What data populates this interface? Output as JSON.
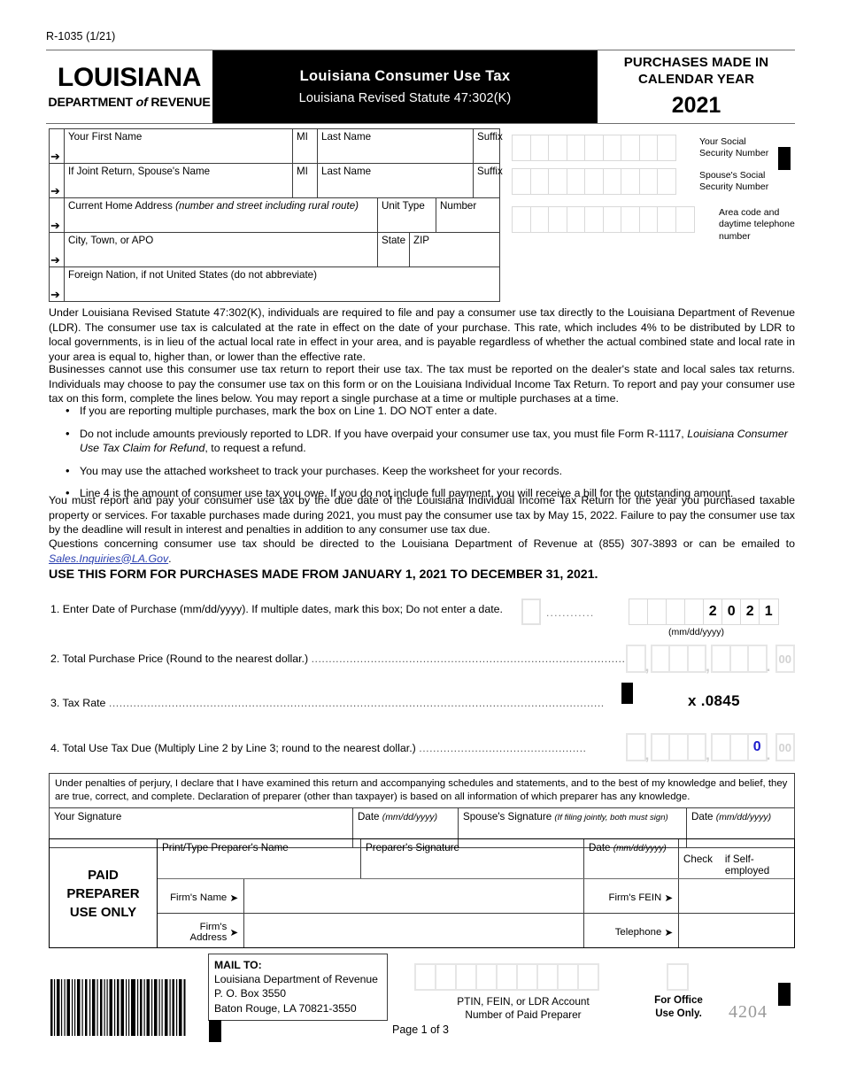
{
  "form": {
    "number": "R-1035 (1/21)",
    "logo_main": "LOUISIANA",
    "logo_sub_1": "DEPARTMENT",
    "logo_sub_of": "of",
    "logo_sub_2": "REVENUE",
    "title": "Louisiana Consumer Use Tax",
    "statute": "Louisiana Revised Statute 47:302(K)",
    "purchases_made_line1": "PURCHASES MADE IN",
    "purchases_made_line2": "CALENDAR YEAR",
    "year": "2021"
  },
  "name_block": {
    "your_first_name": "Your First Name",
    "mi": "MI",
    "last_name": "Last Name",
    "suffix": "Suffix",
    "spouse_name": "If Joint Return, Spouse's Name",
    "mi2": "MI",
    "last_name2": "Last Name",
    "suffix2": "Suffix",
    "address": "Current Home Address",
    "address_italic": "(number and street including rural route)",
    "unit_type": "Unit Type",
    "number": "Number",
    "city": "City, Town, or APO",
    "state": "State",
    "zip": "ZIP",
    "foreign_nation": "Foreign Nation, if not United States (do not abbreviate)"
  },
  "id_block": {
    "your_ssn_line1": "Your Social",
    "your_ssn_line2": "Security Number",
    "spouse_ssn_line1": "Spouse's Social",
    "spouse_ssn_line2": "Security Number",
    "phone_line1": "Area code and",
    "phone_line2": "daytime telephone",
    "phone_line3": "number",
    "ssn_cell_count": 9,
    "phone_cell_count": 10
  },
  "intro": {
    "p1": "Under Louisiana Revised Statute 47:302(K), individuals are required to file and pay a consumer use tax directly to the Louisiana Department of Revenue (LDR). The consumer use tax is calculated at the rate in effect on the date of your purchase. This rate, which includes 4% to be distributed by LDR to local governments, is in lieu of the actual local rate in effect in your area, and is payable regardless of whether the actual combined state and local rate in your area is equal to, higher than, or lower than the effective rate.",
    "p2": "Businesses cannot use this consumer use tax return to report their use tax. The tax must be reported on the dealer's state and local sales tax returns. Individuals may choose to pay the consumer use tax on this form or on the Louisiana Individual Income Tax Return. To report and pay your consumer use tax on this form, complete the lines below. You may report a single purchase at a time or multiple purchases at a time.",
    "bullet1": "If you are reporting multiple purchases, mark the box on Line 1. DO NOT enter a date.",
    "bullet2_a": "Do not include amounts previously reported to LDR. If you have overpaid your consumer use tax, you must file Form R-1117, ",
    "bullet2_i": "Louisiana Consumer Use Tax Claim for Refund",
    "bullet2_b": ", to request a refund.",
    "bullet3": "You may use the attached worksheet to track your purchases. Keep the worksheet for your records.",
    "bullet4": "Line 4 is the amount of consumer use tax you owe. If you do not include full payment, you will receive a bill for the outstanding amount.",
    "p3": "You must report and pay your consumer use tax by the due date of the Louisiana Individual Income Tax Return for the year you purchased taxable property or services. For taxable purchases made during 2021, you must pay the consumer use tax by May 15, 2022. Failure to pay the consumer use tax by the deadline will result in interest and penalties in addition to any consumer use tax due.",
    "p4_a": "Questions concerning consumer use tax should be directed to the Louisiana Department of Revenue at (855) 307-3893 or can be emailed to ",
    "p4_link": "Sales.Inquiries@LA.Gov",
    "p4_b": ".",
    "use_this_form": "USE THIS FORM FOR PURCHASES MADE FROM JANUARY 1, 2021 TO DECEMBER 31, 2021."
  },
  "lines": {
    "line1_label": "1. Enter Date of Purchase (mm/dd/yyyy). If multiple dates, mark this box; Do not enter a date.",
    "line1_dots": "............",
    "line1_date_cells": [
      "",
      "",
      "",
      "",
      "2",
      "0",
      "2",
      "1"
    ],
    "line1_format_hint": "(mm/dd/yyyy)",
    "line2_label": "2. Total Purchase Price (Round to the nearest dollar.)",
    "line2_dots": "..........................................................................................",
    "line2_cents": "00",
    "line3_label": "3. Tax Rate",
    "line3_dots": "..............................................................................................................................................",
    "line3_rate": "x .0845",
    "line4_label": "4. Total Use Tax Due (Multiply Line 2 by Line 3; round to the nearest dollar.)",
    "line4_dots": "................................................",
    "line4_value": "0",
    "line4_cents": "00"
  },
  "signature": {
    "perjury": "Under penalties of perjury, I declare that I have examined this return and accompanying schedules and statements, and to the best of my knowledge and belief, they are true, correct, and complete. Declaration of preparer (other than taxpayer) is based on all information of which preparer has any knowledge.",
    "your_signature": "Your Signature",
    "date1": "Date",
    "date1_fmt": "(mm/dd/yyyy)",
    "spouse_signature": "Spouse's Signature",
    "spouse_signature_note": "(If filing jointly, both must sign)",
    "date2": "Date",
    "date2_fmt": "(mm/dd/yyyy)"
  },
  "preparer": {
    "heading_l1": "PAID",
    "heading_l2": "PREPARER",
    "heading_l3": "USE ONLY",
    "print_name": "Print/Type Preparer's Name",
    "signature": "Preparer's Signature",
    "date": "Date",
    "date_fmt": "(mm/dd/yyyy)",
    "check": "Check",
    "self_employed": "if Self-employed",
    "firms_name": "Firm's Name",
    "firms_fein": "Firm's FEIN",
    "firms_address": "Firm's Address",
    "telephone": "Telephone",
    "arrow": "➤"
  },
  "footer": {
    "mail_title": "MAIL TO:",
    "mail_l1": "Louisiana Department of Revenue",
    "mail_l2": "P. O. Box 3550",
    "mail_l3": "Baton Rouge, LA 70821-3550",
    "ptin_label_l1": "PTIN, FEIN, or LDR Account",
    "ptin_label_l2": "Number of Paid Preparer",
    "ptin_cell_count": 9,
    "office_l1": "For Office",
    "office_l2": "Use Only.",
    "form_code": "4204",
    "page_of": "Page 1 of 3"
  },
  "colors": {
    "header_black": "#000000",
    "cell_gray": "#e0e0e0",
    "link_blue": "#2a3fb0",
    "value_blue": "#1c1ccc",
    "code_gray": "#9a9a9a"
  }
}
